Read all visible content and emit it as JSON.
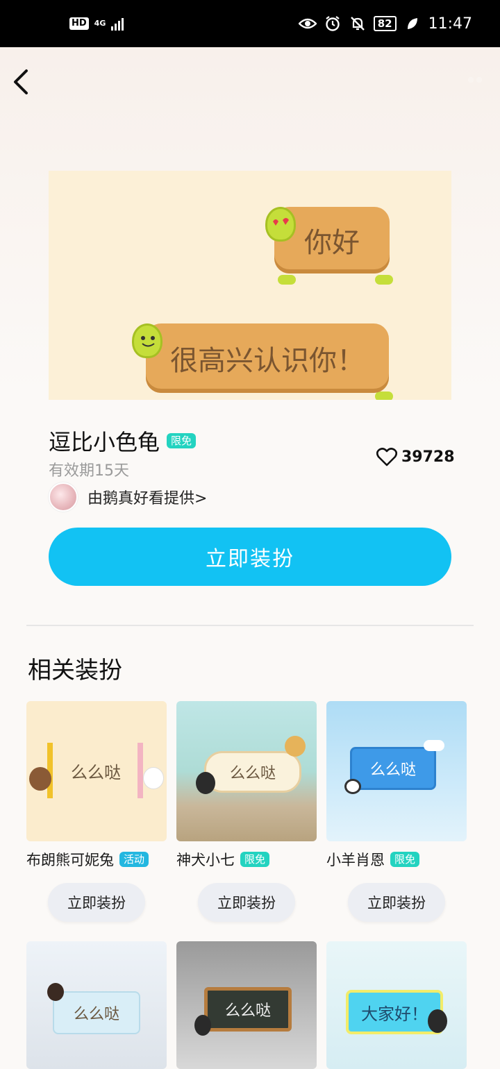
{
  "status_bar": {
    "hd": "HD",
    "network": "4G",
    "battery": "82",
    "time": "11:47"
  },
  "preview": {
    "bubble_1": "你好",
    "bubble_2": "很高兴认识你！"
  },
  "item": {
    "title": "逗比小色龟",
    "tag": "限免",
    "validity": "有效期15天",
    "likes": "39728",
    "provider": "由鹅真好看提供>"
  },
  "main_button": "立即装扮",
  "section_title": "相关装扮",
  "related": [
    {
      "name": "布朗熊可妮兔",
      "tag": "活动",
      "preview_text": "么么哒",
      "button": "立即装扮"
    },
    {
      "name": "神犬小七",
      "tag": "限免",
      "preview_text": "么么哒",
      "button": "立即装扮"
    },
    {
      "name": "小羊肖恩",
      "tag": "限免",
      "preview_text": "么么哒",
      "button": "立即装扮"
    },
    {
      "name": "",
      "tag": "",
      "preview_text": "么么哒",
      "button": ""
    },
    {
      "name": "",
      "tag": "",
      "preview_text": "么么哒",
      "button": ""
    },
    {
      "name": "",
      "tag": "",
      "preview_text": "大家好！",
      "button": ""
    }
  ],
  "colors": {
    "primary_button": "#12c2f3",
    "tag": "#23d3c0"
  }
}
